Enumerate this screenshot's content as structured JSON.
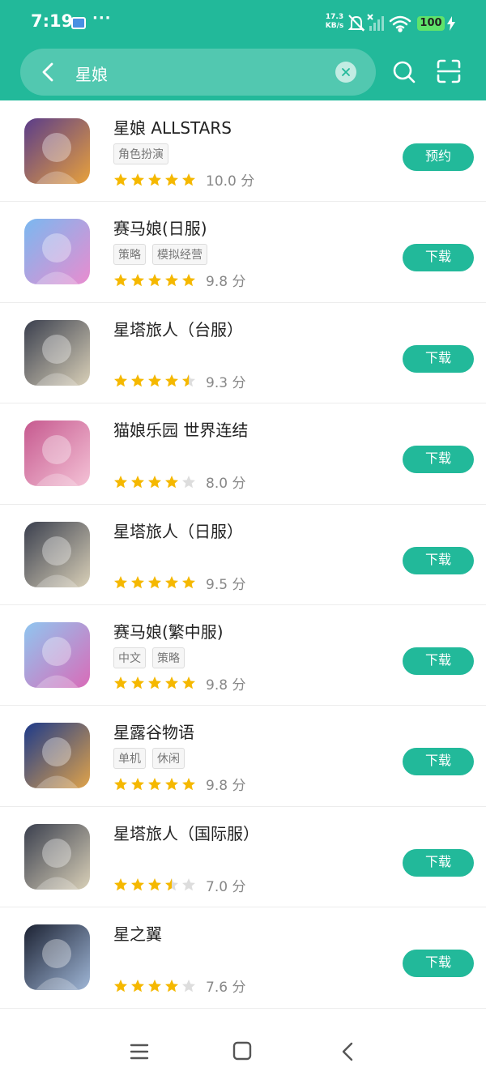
{
  "status_bar": {
    "time": "7:19",
    "more": "···",
    "net_speed_value": "17.3",
    "net_speed_unit": "KB/s",
    "battery": "100"
  },
  "search": {
    "query": "星娘",
    "icons": {
      "back": "chevron-left-icon",
      "clear": "close-icon",
      "search": "search-icon",
      "scan": "scan-icon"
    }
  },
  "apps": [
    {
      "name": "星娘 ALLSTARS",
      "tags": [
        "角色扮演"
      ],
      "stars": 5,
      "score": "10.0 分",
      "button": "预约",
      "icon_colors": [
        "#5a3c8a",
        "#e8a13c"
      ]
    },
    {
      "name": "赛马娘(日服)",
      "tags": [
        "策略",
        "模拟经营"
      ],
      "stars": 5,
      "score": "9.8 分",
      "button": "下载",
      "icon_colors": [
        "#7ab8f0",
        "#e98ccf"
      ]
    },
    {
      "name": "星塔旅人（台服）",
      "tags": [],
      "stars": 4.5,
      "score": "9.3 分",
      "button": "下载",
      "icon_colors": [
        "#3a3f4e",
        "#d9d0b8"
      ]
    },
    {
      "name": "猫娘乐园 世界连结",
      "tags": [],
      "stars": 4,
      "score": "8.0 分",
      "button": "下载",
      "icon_colors": [
        "#c6598f",
        "#f4c2d6"
      ]
    },
    {
      "name": "星塔旅人（日服）",
      "tags": [],
      "stars": 5,
      "score": "9.5 分",
      "button": "下载",
      "icon_colors": [
        "#3a3f4e",
        "#d9d0b8"
      ]
    },
    {
      "name": "赛马娘(繁中服)",
      "tags": [
        "中文",
        "策略"
      ],
      "stars": 5,
      "score": "9.8 分",
      "button": "下载",
      "icon_colors": [
        "#8fc6f0",
        "#d96bb8"
      ]
    },
    {
      "name": "星露谷物语",
      "tags": [
        "单机",
        "休闲"
      ],
      "stars": 5,
      "score": "9.8 分",
      "button": "下载",
      "icon_colors": [
        "#1d3a8a",
        "#e0a34a"
      ]
    },
    {
      "name": "星塔旅人（国际服）",
      "tags": [],
      "stars": 3.5,
      "score": "7.0 分",
      "button": "下载",
      "icon_colors": [
        "#3a3f4e",
        "#d9d0b8"
      ]
    },
    {
      "name": "星之翼",
      "tags": [],
      "stars": 4,
      "score": "7.6 分",
      "button": "下载",
      "icon_colors": [
        "#1c2233",
        "#9fb6d6"
      ]
    }
  ],
  "colors": {
    "accent": "#22b99a",
    "star_filled": "#f5b800",
    "star_empty": "#dddddd"
  },
  "bottom_nav": {
    "icons": [
      "menu-icon",
      "home-icon",
      "back-icon"
    ]
  }
}
